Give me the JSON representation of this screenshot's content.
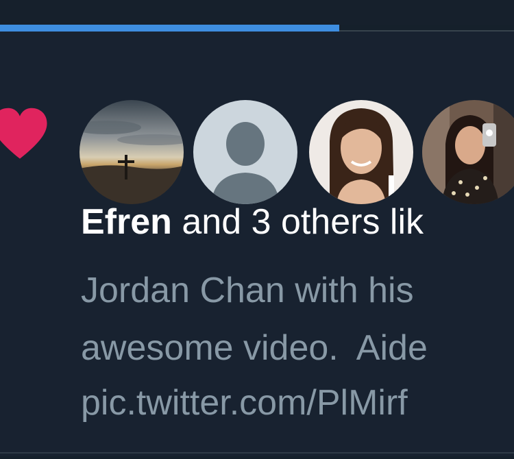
{
  "header": {
    "progress_fraction": 0.66
  },
  "notification": {
    "type": "like",
    "icon": "heart-icon",
    "accent_color": "#e0245e",
    "avatars": [
      {
        "icon": "landscape-cross-photo"
      },
      {
        "icon": "default-profile-icon"
      },
      {
        "icon": "profile-photo-woman"
      },
      {
        "icon": "profile-photo-woman-mirror-selfie"
      }
    ],
    "actor_name": "Efren",
    "action_text": " and 3 others lik",
    "preview_lines": [
      "Jordan Chan with his",
      "awesome video.  Aide",
      "pic.twitter.com/PlMirf"
    ]
  },
  "colors": {
    "background": "#15202b",
    "primary_text": "#ffffff",
    "secondary_text": "#8899a6",
    "progress": "#3e8ee0"
  }
}
